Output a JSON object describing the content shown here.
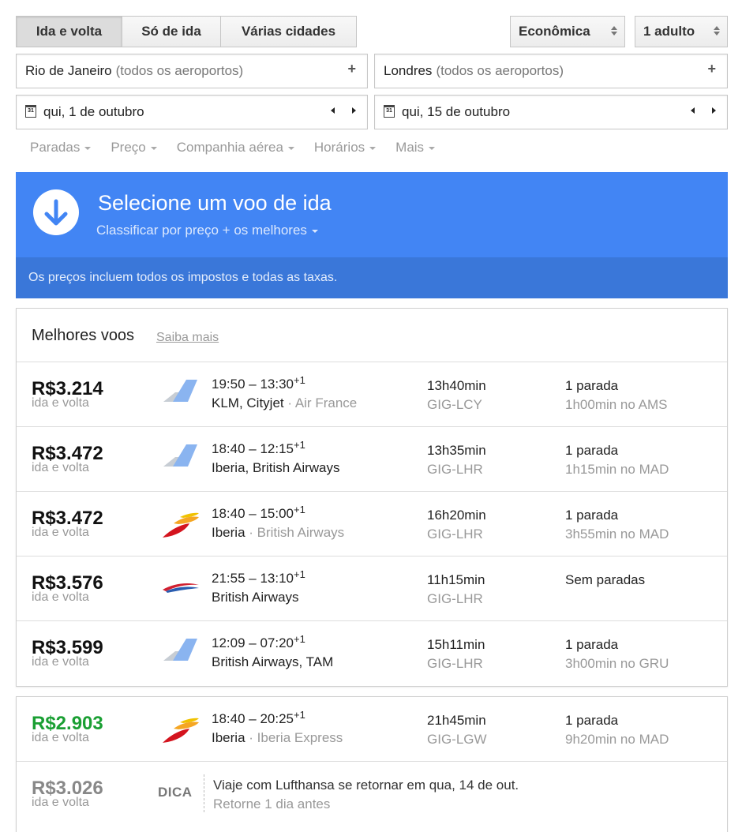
{
  "trip_types": [
    "Ida e volta",
    "Só de ida",
    "Várias cidades"
  ],
  "cabin": "Econômica",
  "passengers": "1 adulto",
  "origin": {
    "city": "Rio de Janeiro",
    "note": "(todos os aeroportos)",
    "add": "+"
  },
  "destination": {
    "city": "Londres",
    "note": "(todos os aeroportos)",
    "add": "+"
  },
  "depart_date": "qui, 1 de outubro",
  "return_date": "qui, 15 de outubro",
  "calendar_day": "31",
  "filters": [
    "Paradas",
    "Preço",
    "Companhia aérea",
    "Horários",
    "Mais"
  ],
  "banner": {
    "title": "Selecione um voo de ida",
    "sort": "Classificar por preço + os melhores",
    "note": "Os preços incluem todos os impostos e todas as taxas."
  },
  "best": {
    "title": "Melhores voos",
    "link": "Saiba mais",
    "flights": [
      {
        "price": "R$3.214",
        "sub": "ida e volta",
        "logo": "generic-tail-icon",
        "dep": "19:50",
        "arr": "13:30",
        "plus": "+1",
        "carrier": "KLM, Cityjet",
        "partner": "Air France",
        "duration": "13h40min",
        "route": "GIG-LCY",
        "stops": "1 parada",
        "layover": "1h00min no AMS"
      },
      {
        "price": "R$3.472",
        "sub": "ida e volta",
        "logo": "generic-tail-icon",
        "dep": "18:40",
        "arr": "12:15",
        "plus": "+1",
        "carrier": "Iberia, British Airways",
        "partner": "",
        "duration": "13h35min",
        "route": "GIG-LHR",
        "stops": "1 parada",
        "layover": "1h15min no MAD"
      },
      {
        "price": "R$3.472",
        "sub": "ida e volta",
        "logo": "iberia-logo-icon",
        "dep": "18:40",
        "arr": "15:00",
        "plus": "+1",
        "carrier": "Iberia",
        "partner": "British Airways",
        "duration": "16h20min",
        "route": "GIG-LHR",
        "stops": "1 parada",
        "layover": "3h55min no MAD"
      },
      {
        "price": "R$3.576",
        "sub": "ida e volta",
        "logo": "british-airways-logo-icon",
        "dep": "21:55",
        "arr": "13:10",
        "plus": "+1",
        "carrier": "British Airways",
        "partner": "",
        "duration": "11h15min",
        "route": "GIG-LHR",
        "stops": "Sem paradas",
        "layover": ""
      },
      {
        "price": "R$3.599",
        "sub": "ida e volta",
        "logo": "generic-tail-icon",
        "dep": "12:09",
        "arr": "07:20",
        "plus": "+1",
        "carrier": "British Airways, TAM",
        "partner": "",
        "duration": "15h11min",
        "route": "GIG-LHR",
        "stops": "1 parada",
        "layover": "3h00min no GRU"
      }
    ]
  },
  "other": {
    "flight": {
      "price": "R$2.903",
      "sub": "ida e volta",
      "logo": "iberia-logo-icon",
      "dep": "18:40",
      "arr": "20:25",
      "plus": "+1",
      "carrier": "Iberia",
      "partner": "Iberia Express",
      "duration": "21h45min",
      "route": "GIG-LGW",
      "stops": "1 parada",
      "layover": "9h20min no MAD"
    },
    "tip": {
      "price": "R$3.026",
      "sub": "ida e volta",
      "label": "DICA",
      "text": "Viaje com Lufthansa se retornar em qua, 14 de out.",
      "subtext": "Retorne 1 dia antes"
    }
  },
  "colors": {
    "banner": "#4285f4",
    "banner_note": "#3a77d9",
    "cheapest_price": "#1a9f33"
  }
}
